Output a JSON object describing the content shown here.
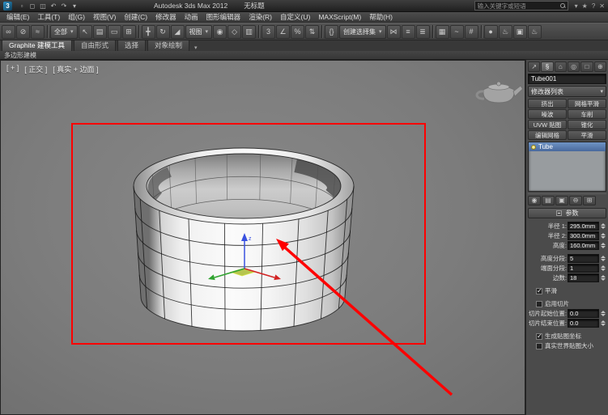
{
  "title_bar": {
    "logo": "3",
    "app_title": "Autodesk 3ds Max 2012",
    "document_title": "无标题",
    "search_placeholder": "输入关键字或短语",
    "quick_access_icons": [
      {
        "name": "new-file-icon",
        "glyph": "▫"
      },
      {
        "name": "open-file-icon",
        "glyph": "◻"
      },
      {
        "name": "save-file-icon",
        "glyph": "◫"
      },
      {
        "name": "undo-icon",
        "glyph": "↶"
      },
      {
        "name": "redo-icon",
        "glyph": "↷"
      },
      {
        "name": "workspace-dropdown-icon",
        "glyph": "▾"
      }
    ],
    "right_icons": [
      {
        "name": "infocenter-dropdown-icon",
        "glyph": "▾"
      },
      {
        "name": "favorites-icon",
        "glyph": "★"
      },
      {
        "name": "help-icon",
        "glyph": "?"
      },
      {
        "name": "close-icon",
        "glyph": "✕"
      }
    ]
  },
  "menu_bar": {
    "items": [
      "编辑(E)",
      "工具(T)",
      "组(G)",
      "视图(V)",
      "创建(C)",
      "修改器",
      "动画",
      "图形编辑器",
      "渲染(R)",
      "自定义(U)",
      "MAXScript(M)",
      "帮助(H)"
    ]
  },
  "toolbar": {
    "selection_filter": "全部",
    "reference_coordinate": "视图",
    "named_selection_placeholder": "创建选择集",
    "dropdown_arrow": "▾",
    "icons": [
      {
        "name": "select-and-link-icon",
        "glyph": "∞"
      },
      {
        "name": "unlink-selection-icon",
        "glyph": "⊘"
      },
      {
        "name": "bind-to-spacewarp-icon",
        "glyph": "≈"
      },
      {
        "name": "select-object-icon",
        "glyph": "↖"
      },
      {
        "name": "select-by-name-icon",
        "glyph": "▤"
      },
      {
        "name": "rectangular-selection-icon",
        "glyph": "▭"
      },
      {
        "name": "window-crossing-icon",
        "glyph": "⊞"
      },
      {
        "name": "select-and-move-icon",
        "glyph": "╋"
      },
      {
        "name": "select-and-rotate-icon",
        "glyph": "↻"
      },
      {
        "name": "select-and-scale-icon",
        "glyph": "◢"
      },
      {
        "name": "use-pivot-center-icon",
        "glyph": "◉"
      },
      {
        "name": "select-and-manipulate-icon",
        "glyph": "◇"
      },
      {
        "name": "keyboard-override-icon",
        "glyph": "▥"
      },
      {
        "name": "snaps-toggle-icon",
        "glyph": "3"
      },
      {
        "name": "angle-snap-icon",
        "glyph": "∠"
      },
      {
        "name": "percent-snap-icon",
        "glyph": "%"
      },
      {
        "name": "spinner-snap-icon",
        "glyph": "⇅"
      },
      {
        "name": "edit-named-sets-icon",
        "glyph": "{}"
      },
      {
        "name": "mirror-icon",
        "glyph": "⋈"
      },
      {
        "name": "align-icon",
        "glyph": "≡"
      },
      {
        "name": "layer-manager-icon",
        "glyph": "≣"
      },
      {
        "name": "graphite-ribbon-icon",
        "glyph": "▦"
      },
      {
        "name": "curve-editor-icon",
        "glyph": "~"
      },
      {
        "name": "schematic-view-icon",
        "glyph": "#"
      },
      {
        "name": "material-editor-icon",
        "glyph": "●"
      },
      {
        "name": "render-setup-icon",
        "glyph": "♨"
      },
      {
        "name": "rendered-frame-icon",
        "glyph": "▣"
      },
      {
        "name": "render-production-icon",
        "glyph": "♨"
      }
    ]
  },
  "ribbon": {
    "tabs": [
      "Graphite 建模工具",
      "自由形式",
      "选择",
      "对象绘制"
    ],
    "collapse_icon": "▾",
    "panel_label": "多边形建模"
  },
  "viewport": {
    "pov_label": "[ + ]",
    "view_label": "[ 正交 ]",
    "shading_label": "[ 真实 + 边面 ]"
  },
  "command_panel": {
    "tabs": [
      {
        "name": "create-tab-icon",
        "glyph": "↗"
      },
      {
        "name": "modify-tab-icon",
        "glyph": "§"
      },
      {
        "name": "hierarchy-tab-icon",
        "glyph": "⌂"
      },
      {
        "name": "motion-tab-icon",
        "glyph": "◎"
      },
      {
        "name": "display-tab-icon",
        "glyph": "□"
      },
      {
        "name": "utilities-tab-icon",
        "glyph": "⊕"
      }
    ],
    "object_name": "Tube001",
    "modifier_list_label": "修改器列表",
    "modifier_buttons": [
      "挤出",
      "网格平滑",
      "噪波",
      "车削",
      "UVW 贴图",
      "锥化",
      "编辑网格",
      "平滑"
    ],
    "stack": {
      "items": [
        {
          "label": "Tube",
          "selected": true
        }
      ]
    },
    "stack_tools": [
      {
        "name": "pin-stack-icon",
        "glyph": "◉"
      },
      {
        "name": "show-end-result-icon",
        "glyph": "▤"
      },
      {
        "name": "make-unique-icon",
        "glyph": "▣"
      },
      {
        "name": "remove-modifier-icon",
        "glyph": "⊖"
      },
      {
        "name": "configure-modifier-sets-icon",
        "glyph": "⊞"
      }
    ],
    "params": {
      "rollout_title": "参数",
      "radius1_label": "半径 1:",
      "radius1": "295.0mm",
      "radius2_label": "半径 2:",
      "radius2": "300.0mm",
      "height_label": "高度:",
      "height": "160.0mm",
      "height_segs_label": "高度分段:",
      "height_segs": "5",
      "cap_segs_label": "端面分段:",
      "cap_segs": "1",
      "sides_label": "边数:",
      "sides": "18",
      "smooth_label": "平滑",
      "smooth_checked": true,
      "slice_on_label": "启用切片",
      "slice_on_checked": false,
      "slice_from_label": "切片起始位置:",
      "slice_from": "0.0",
      "slice_to_label": "切片结束位置:",
      "slice_to": "0.0",
      "gen_map_label": "生成贴图坐标",
      "gen_map_checked": true,
      "real_world_label": "真实世界贴图大小",
      "real_world_checked": false
    }
  },
  "annotation": {
    "color": "#fe0000"
  }
}
